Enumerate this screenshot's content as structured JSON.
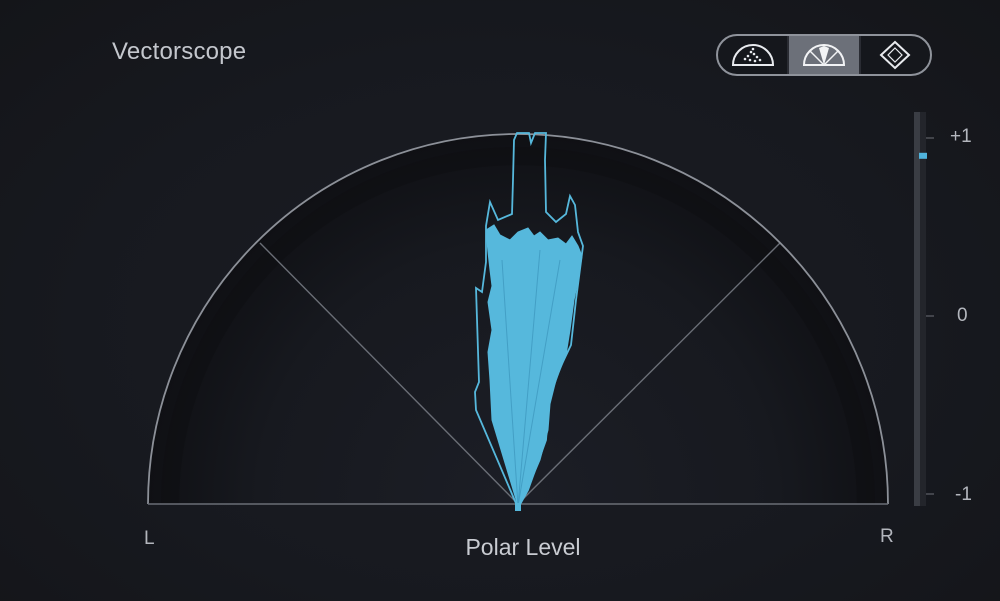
{
  "header": {
    "title": "Vectorscope"
  },
  "modes": [
    {
      "icon": "polar-sample-icon",
      "active": false
    },
    {
      "icon": "polar-level-icon",
      "active": true
    },
    {
      "icon": "lissajous-icon",
      "active": false
    }
  ],
  "scope": {
    "left_label": "L",
    "right_label": "R",
    "mode_label": "Polar Level",
    "trace_color": "#56b8dc",
    "arc_color": "#8c9098"
  },
  "correlation_meter": {
    "top_label": "+1",
    "mid_label": "0",
    "bottom_label": "-1",
    "value": 0.9,
    "indicator_color": "#4fb3dc"
  }
}
